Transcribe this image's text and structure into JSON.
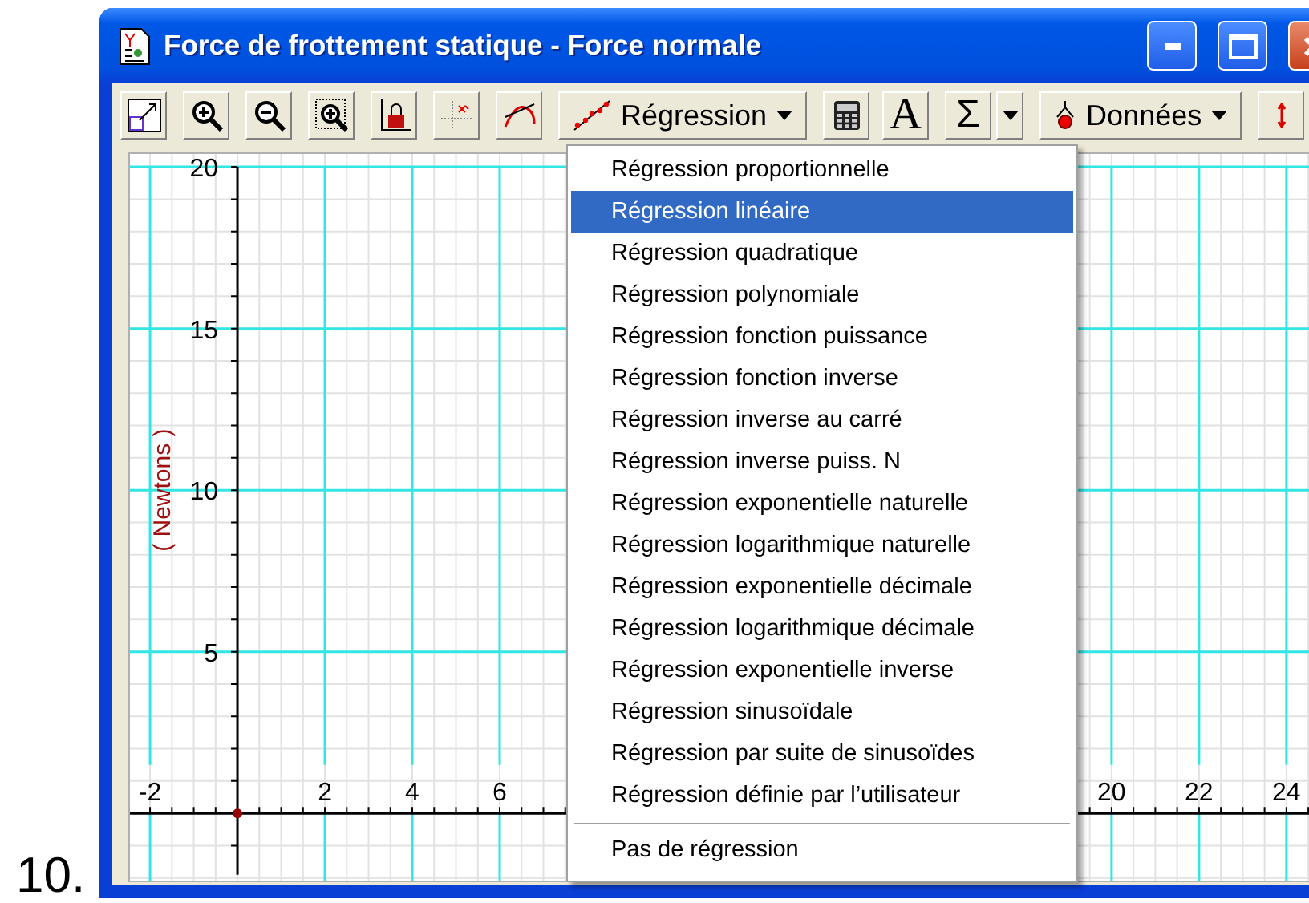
{
  "page": {
    "item_number": "10."
  },
  "window": {
    "title": "Force de frottement statique - Force normale"
  },
  "toolbar": {
    "regression_button": {
      "label": "Régression",
      "expanded": true
    },
    "text_button": {
      "label": "A"
    },
    "sum_button": {
      "label": "Σ"
    },
    "data_button": {
      "label": "Données"
    }
  },
  "plot": {
    "chart_data": {
      "type": "scatter",
      "ylabel": "( Newtons )",
      "grid": true,
      "xlim": [
        -2.46,
        24.7
      ],
      "ylim": [
        -2.18,
        20.4
      ],
      "xticks": [
        -2,
        2,
        4,
        6,
        20,
        22,
        24
      ],
      "yticks": [
        5,
        10,
        15,
        20
      ],
      "x": [
        0
      ],
      "series": [
        {
          "color": "#990000",
          "values": [
            0
          ]
        }
      ]
    }
  },
  "menu": {
    "items": [
      {
        "label": "Régression proportionnelle",
        "selected": false
      },
      {
        "label": "Régression linéaire",
        "selected": true
      },
      {
        "label": "Régression quadratique",
        "selected": false
      },
      {
        "label": "Régression polynomiale",
        "selected": false
      },
      {
        "label": "Régression fonction puissance",
        "selected": false
      },
      {
        "label": "Régression fonction inverse",
        "selected": false
      },
      {
        "label": "Régression inverse au carré",
        "selected": false
      },
      {
        "label": "Régression inverse puiss. N",
        "selected": false
      },
      {
        "label": "Régression exponentielle naturelle",
        "selected": false
      },
      {
        "label": "Régression logarithmique naturelle",
        "selected": false
      },
      {
        "label": "Régression exponentielle décimale",
        "selected": false
      },
      {
        "label": "Régression logarithmique décimale",
        "selected": false
      },
      {
        "label": "Régression exponentielle inverse",
        "selected": false
      },
      {
        "label": "Régression sinusoïdale",
        "selected": false
      },
      {
        "label": "Régression par suite de sinusoïdes",
        "selected": false
      },
      {
        "label": "Régression définie par l’utilisateur",
        "selected": false
      }
    ],
    "footer_items": [
      {
        "label": "Pas de régression",
        "selected": false
      }
    ]
  }
}
